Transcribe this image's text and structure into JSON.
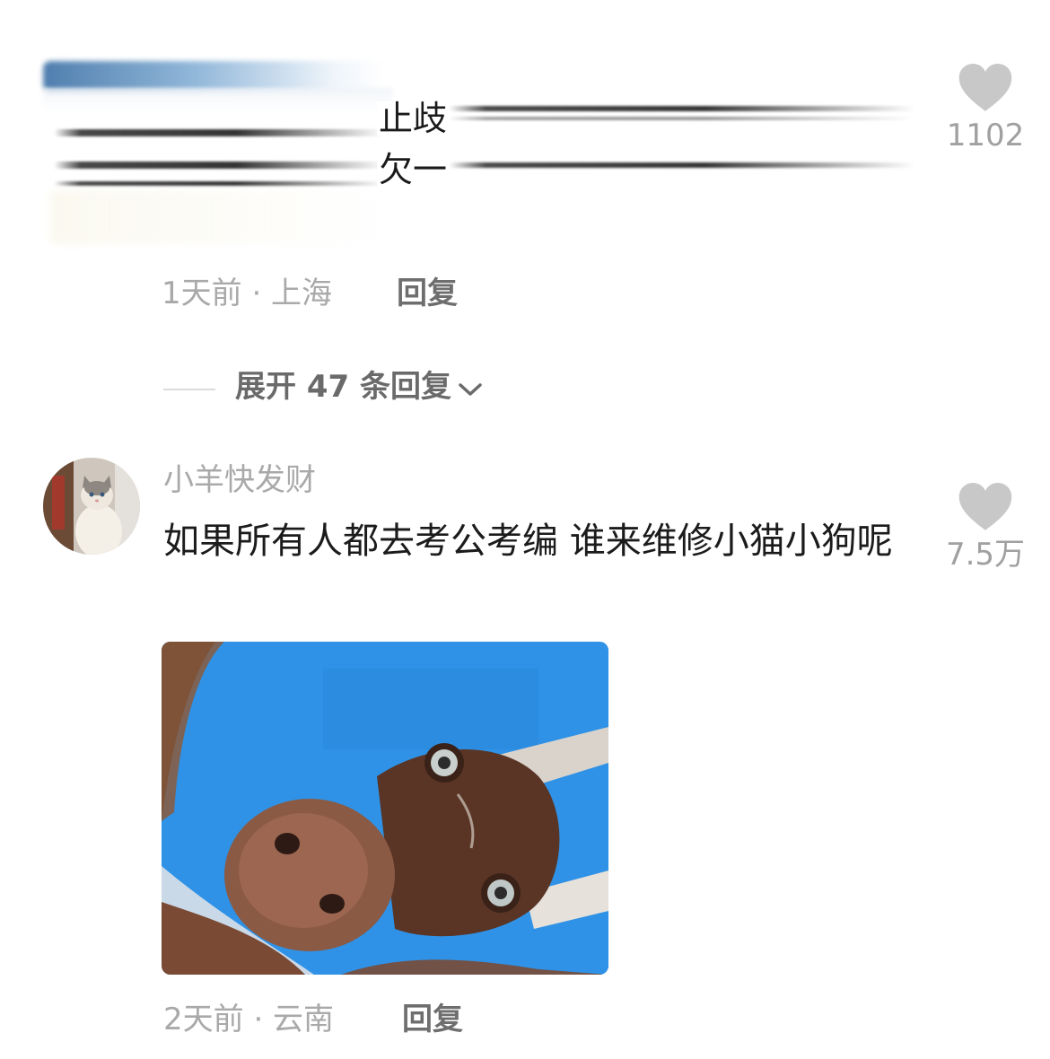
{
  "comment_1": {
    "text_fragments": [
      "止歧",
      "欠一"
    ],
    "meta": "1天前 · 上海",
    "reply_label": "回复",
    "likes": "1102"
  },
  "expand_replies": {
    "label": "展开 47 条回复",
    "icon": "chevron-down-icon"
  },
  "comment_2": {
    "username": "小羊快发财",
    "text": "如果所有人都去考公考编 谁来维修小猫小狗呢",
    "meta": "2天前 · 云南",
    "reply_label": "回复",
    "likes": "7.5万",
    "avatar_icon": "cat-avatar",
    "image_icon": "dog-cone-photo"
  },
  "colors": {
    "meta_gray": "#a9a9a9",
    "reply_gray": "#6e6e6e",
    "heart_gray": "#c8c8c8",
    "text": "#1b1b1b",
    "photo_blue": "#2b8ee4"
  }
}
